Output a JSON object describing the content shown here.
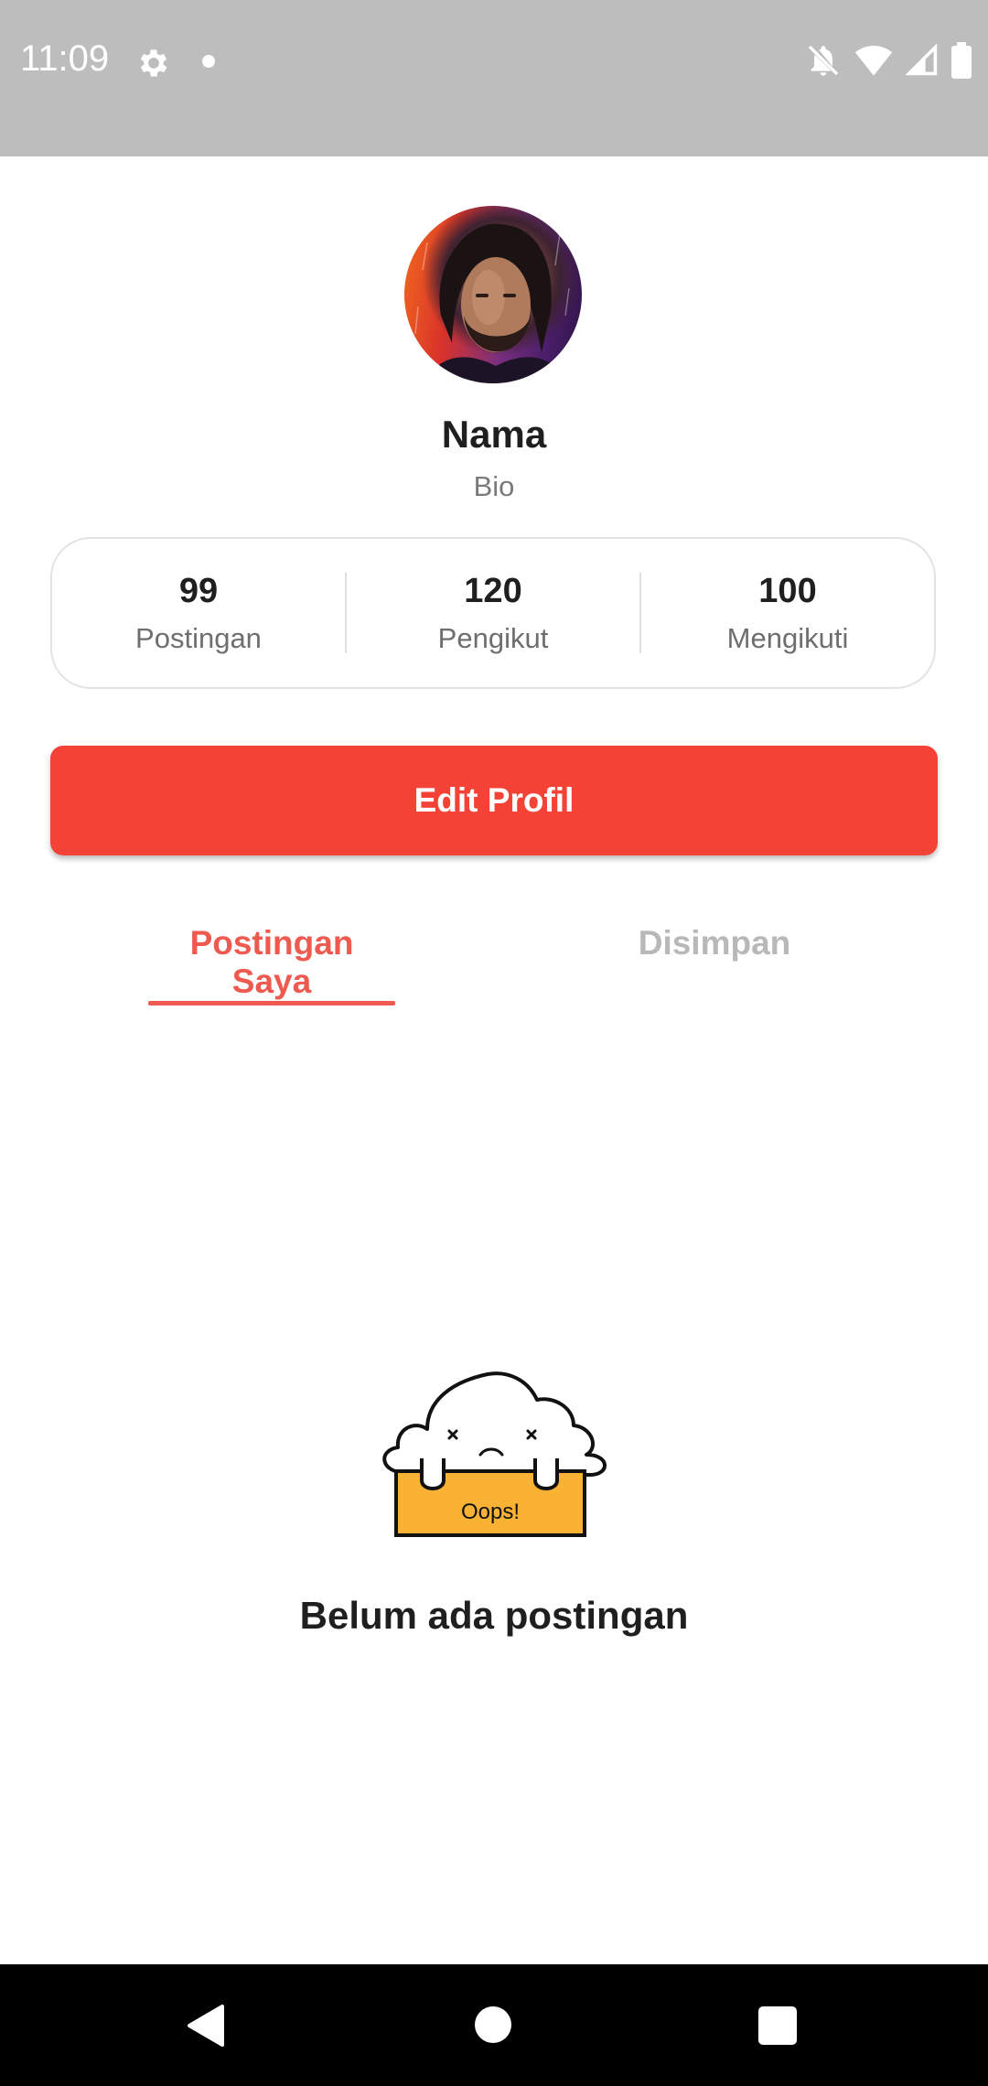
{
  "status_bar": {
    "time": "11:09",
    "icons": [
      "gear-icon",
      "notification-dot",
      "bell-off-icon",
      "wifi-icon",
      "signal-icon",
      "battery-icon"
    ],
    "background": "#bdbdbd"
  },
  "profile": {
    "name": "Nama",
    "bio": "Bio",
    "avatar": "profile-photo"
  },
  "stats": [
    {
      "value": "99",
      "label": "Postingan"
    },
    {
      "value": "120",
      "label": "Pengikut"
    },
    {
      "value": "100",
      "label": "Mengikuti"
    }
  ],
  "actions": {
    "edit_profile_label": "Edit Profil"
  },
  "tabs": [
    {
      "label": "Postingan Saya",
      "active": true
    },
    {
      "label": "Disimpan",
      "active": false
    }
  ],
  "empty_state": {
    "illustration_text": "Oops!",
    "message": "Belum ada postingan"
  },
  "nav_bar": {
    "buttons": [
      "back-icon",
      "home-icon",
      "recents-icon"
    ]
  },
  "colors": {
    "accent": "#f44336",
    "tab_active": "#ee5a4f",
    "tab_inactive": "#b8b8b8",
    "illustration_box": "#f9b233"
  }
}
